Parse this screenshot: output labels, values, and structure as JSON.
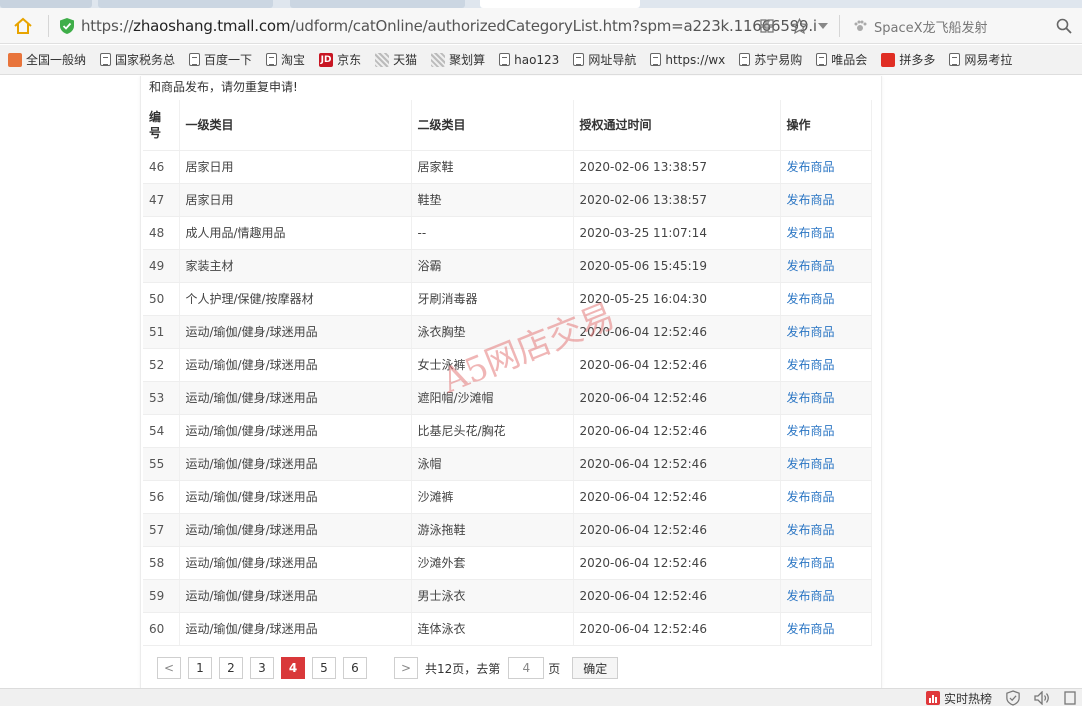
{
  "browser": {
    "url_scheme": "https://",
    "url_host": "zhaoshang.tmall.com",
    "url_path": "/udform/catOnline/authorizedCategoryList.htm?spm=a223k.11666599.i",
    "search_placeholder": "SpaceX龙飞船发射",
    "bookmarks": [
      {
        "label": "全国一般纳",
        "icon_color": "#e8743b"
      },
      {
        "label": "国家税务总",
        "icon_color": "doc"
      },
      {
        "label": "百度一下",
        "icon_color": "doc"
      },
      {
        "label": "淘宝",
        "icon_color": "doc"
      },
      {
        "label": "京东",
        "icon_color": "#c81623"
      },
      {
        "label": "天猫",
        "icon_color": "hatch"
      },
      {
        "label": "聚划算",
        "icon_color": "hatch"
      },
      {
        "label": "hao123",
        "icon_color": "doc"
      },
      {
        "label": "网址导航",
        "icon_color": "doc"
      },
      {
        "label": "https://wx",
        "icon_color": "doc"
      },
      {
        "label": "苏宁易购",
        "icon_color": "doc"
      },
      {
        "label": "唯品会",
        "icon_color": "doc"
      },
      {
        "label": "拼多多",
        "icon_color": "#e02e24"
      },
      {
        "label": "网易考拉",
        "icon_color": "doc"
      }
    ],
    "jd_logo_text": "JD"
  },
  "page": {
    "notice": "和商品发布，请勿重复申请!",
    "table": {
      "headers": {
        "num_line1": "编",
        "num_line2": "号",
        "cat1": "一级类目",
        "cat2": "二级类目",
        "time": "授权通过时间",
        "op": "操作"
      },
      "rows": [
        {
          "num": "46",
          "cat1": "居家日用",
          "cat2": "居家鞋",
          "time": "2020-02-06 13:38:57",
          "op": "发布商品"
        },
        {
          "num": "47",
          "cat1": "居家日用",
          "cat2": "鞋垫",
          "time": "2020-02-06 13:38:57",
          "op": "发布商品"
        },
        {
          "num": "48",
          "cat1": "成人用品/情趣用品",
          "cat2": "--",
          "time": "2020-03-25 11:07:14",
          "op": "发布商品"
        },
        {
          "num": "49",
          "cat1": "家装主材",
          "cat2": "浴霸",
          "time": "2020-05-06 15:45:19",
          "op": "发布商品"
        },
        {
          "num": "50",
          "cat1": "个人护理/保健/按摩器材",
          "cat2": "牙刷消毒器",
          "time": "2020-05-25 16:04:30",
          "op": "发布商品"
        },
        {
          "num": "51",
          "cat1": "运动/瑜伽/健身/球迷用品",
          "cat2": "泳衣胸垫",
          "time": "2020-06-04 12:52:46",
          "op": "发布商品"
        },
        {
          "num": "52",
          "cat1": "运动/瑜伽/健身/球迷用品",
          "cat2": "女士泳裤",
          "time": "2020-06-04 12:52:46",
          "op": "发布商品"
        },
        {
          "num": "53",
          "cat1": "运动/瑜伽/健身/球迷用品",
          "cat2": "遮阳帽/沙滩帽",
          "time": "2020-06-04 12:52:46",
          "op": "发布商品"
        },
        {
          "num": "54",
          "cat1": "运动/瑜伽/健身/球迷用品",
          "cat2": "比基尼头花/胸花",
          "time": "2020-06-04 12:52:46",
          "op": "发布商品"
        },
        {
          "num": "55",
          "cat1": "运动/瑜伽/健身/球迷用品",
          "cat2": "泳帽",
          "time": "2020-06-04 12:52:46",
          "op": "发布商品"
        },
        {
          "num": "56",
          "cat1": "运动/瑜伽/健身/球迷用品",
          "cat2": "沙滩裤",
          "time": "2020-06-04 12:52:46",
          "op": "发布商品"
        },
        {
          "num": "57",
          "cat1": "运动/瑜伽/健身/球迷用品",
          "cat2": "游泳拖鞋",
          "time": "2020-06-04 12:52:46",
          "op": "发布商品"
        },
        {
          "num": "58",
          "cat1": "运动/瑜伽/健身/球迷用品",
          "cat2": "沙滩外套",
          "time": "2020-06-04 12:52:46",
          "op": "发布商品"
        },
        {
          "num": "59",
          "cat1": "运动/瑜伽/健身/球迷用品",
          "cat2": "男士泳衣",
          "time": "2020-06-04 12:52:46",
          "op": "发布商品"
        },
        {
          "num": "60",
          "cat1": "运动/瑜伽/健身/球迷用品",
          "cat2": "连体泳衣",
          "time": "2020-06-04 12:52:46",
          "op": "发布商品"
        }
      ]
    },
    "watermark": "A5网店交易",
    "pagination": {
      "prev": "<",
      "next": ">",
      "pages": [
        "1",
        "2",
        "3",
        "4",
        "5",
        "6"
      ],
      "current": "4",
      "total_text": "共12页，去第",
      "input_value": "4",
      "page_suffix": "页",
      "confirm": "确定"
    }
  },
  "statusbar": {
    "hot_label": "实时热榜"
  },
  "colors": {
    "link": "#2b76c4",
    "active_page": "#d9383a"
  }
}
